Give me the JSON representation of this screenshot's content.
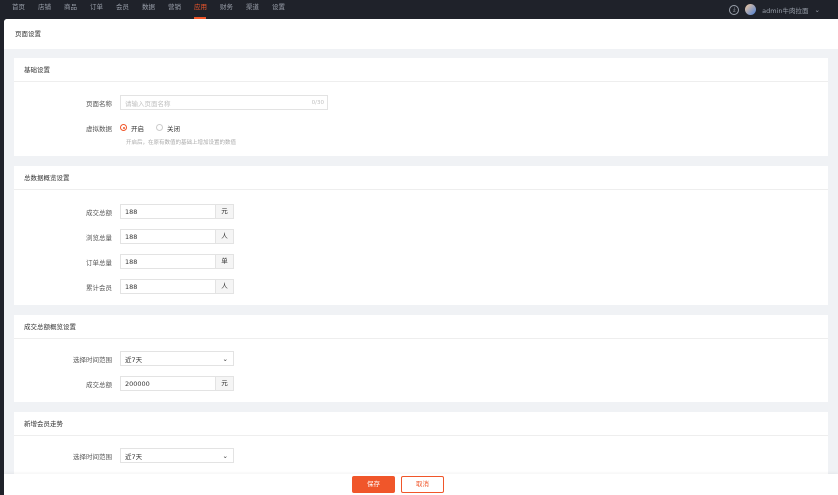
{
  "nav": [
    "首页",
    "店铺",
    "商品",
    "订单",
    "会员",
    "数据",
    "营销",
    "应用",
    "财务",
    "渠道",
    "设置"
  ],
  "nav_active": 7,
  "user": {
    "name": "admin牛肉拉面",
    "caret": "⌄",
    "download_icon": "⤓"
  },
  "page_title": "页面设置",
  "basic": {
    "title": "基础设置",
    "name_label": "页面名称",
    "name_placeholder": "请输入页面名称",
    "name_count": "0/30",
    "virtual_label": "虚拟数据",
    "opt_on": "开启",
    "opt_off": "关闭",
    "hint": "开启后，在原有数值的基础上增加设置的数值"
  },
  "overview": {
    "title": "总数据概览设置",
    "rows": [
      {
        "label": "成交总额",
        "value": "188",
        "unit": "元"
      },
      {
        "label": "浏览总量",
        "value": "188",
        "unit": "人"
      },
      {
        "label": "订单总量",
        "value": "188",
        "unit": "单"
      },
      {
        "label": "累计会员",
        "value": "188",
        "unit": "人"
      }
    ]
  },
  "deal": {
    "title": "成交总额概览设置",
    "range_label": "选择时间范围",
    "range_value": "近7天",
    "amount_label": "成交总额",
    "amount_value": "200000",
    "amount_unit": "元"
  },
  "member": {
    "title": "新增会员走势",
    "range_label": "选择时间范围",
    "range_value": "近7天"
  },
  "footer": {
    "save": "保存",
    "cancel": "取消"
  },
  "colors": {
    "accent": "#f0562a",
    "topbar": "#1f222a"
  }
}
